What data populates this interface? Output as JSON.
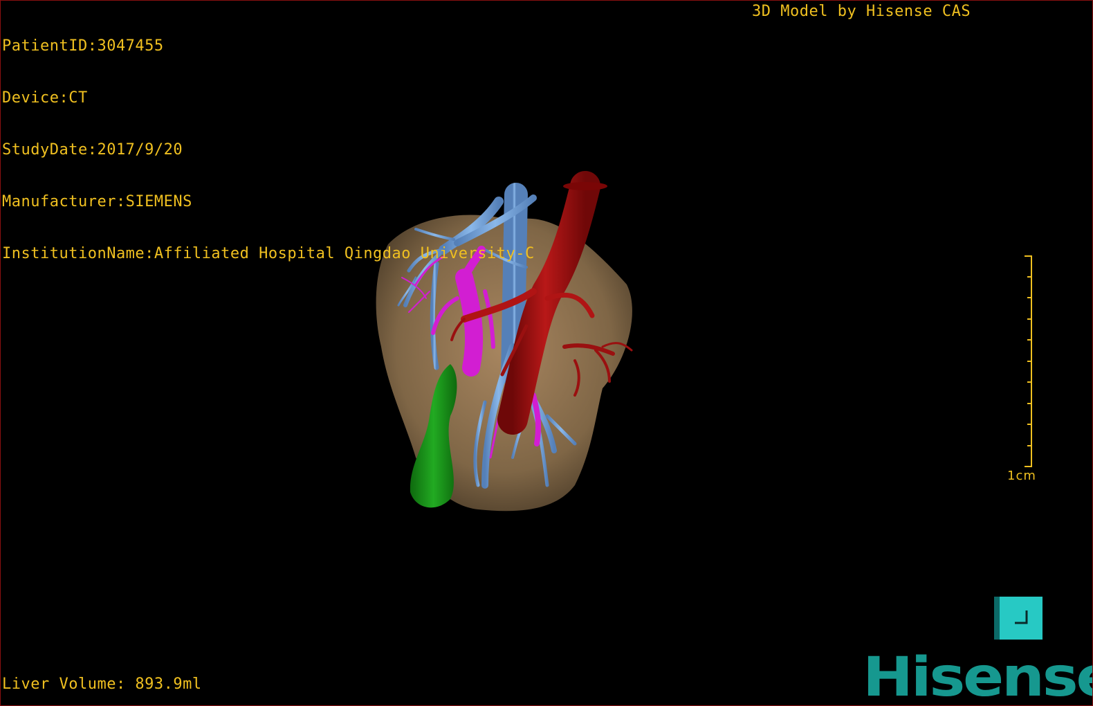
{
  "patient_info": {
    "patient_id": "PatientID:3047455",
    "device": "Device:CT",
    "study_date": "StudyDate:2017/9/20",
    "manufacturer": "Manufacturer:SIEMENS",
    "institution": "InstitutionName:Affiliated Hospital Qingdao University-C"
  },
  "model_credit": "3D Model by Hisense CAS",
  "scale": {
    "label": "1cm"
  },
  "liver_volume": "Liver Volume: 893.9ml",
  "brand": {
    "logo_text": "Hisense",
    "color": "#16988f"
  },
  "view_button": {
    "icon": "corner-view-icon",
    "color": "#27c9c4"
  },
  "colors": {
    "overlay_text": "#f0c020",
    "liver": "#a88660",
    "hepatic_vein": "#74a8e0",
    "portal_vein": "#d21ed2",
    "artery": "#a01010",
    "gallbladder": "#1e9a1e"
  }
}
